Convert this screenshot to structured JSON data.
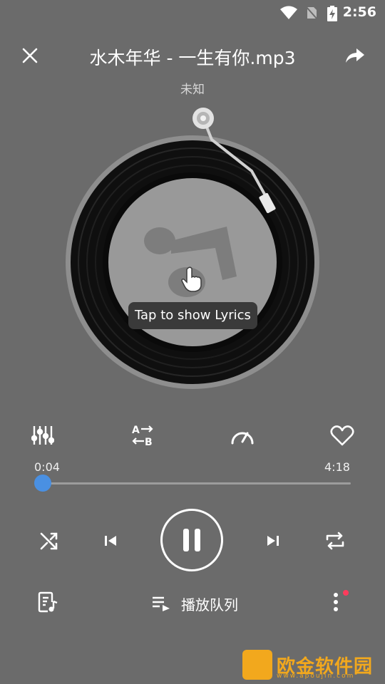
{
  "status_bar": {
    "time": "2:56"
  },
  "header": {
    "title": "水木年华 - 一生有你.mp3",
    "artist": "未知"
  },
  "disc": {
    "tooltip": "Tap to show Lyrics"
  },
  "progress": {
    "current": "0:04",
    "total": "4:18",
    "fraction": 0.016
  },
  "bottom": {
    "queue_label": "播放队列"
  },
  "watermark": {
    "text": "欧金软件园",
    "url": "www.apoujin.com"
  },
  "colors": {
    "background": "#6b6b6b",
    "accent": "#4a90e2",
    "badge": "#ff3b5c"
  }
}
